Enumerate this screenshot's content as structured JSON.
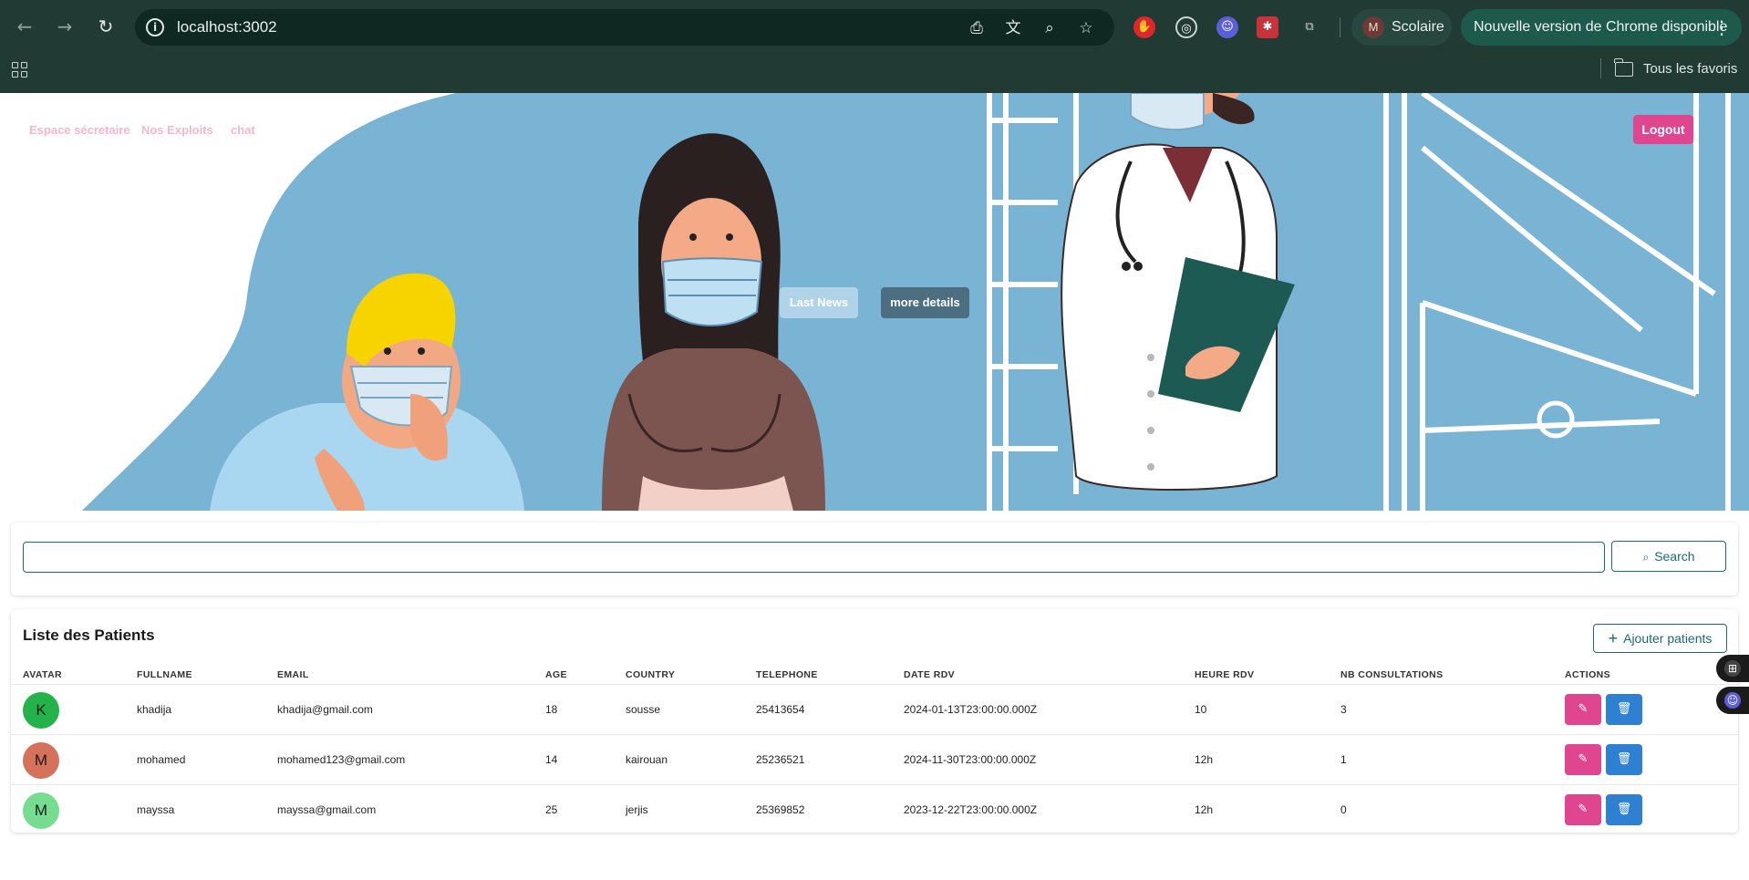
{
  "browser": {
    "url": "localhost:3002",
    "profile_name": "Scolaire",
    "profile_initial": "M",
    "update_text": "Nouvelle version de Chrome disponible",
    "bookmarks_label": "Tous les favoris"
  },
  "header": {
    "nav": [
      "Espace sécretaire",
      "Nos Exploits",
      "chat"
    ],
    "logout_label": "Logout",
    "hero_button_1": "Last News",
    "hero_button_2": "more details"
  },
  "search": {
    "value": "",
    "button_label": "Search"
  },
  "patients": {
    "title": "Liste des Patients",
    "add_label": "Ajouter patients",
    "columns": [
      "AVATAR",
      "FULLNAME",
      "EMAIL",
      "AGE",
      "COUNTRY",
      "TELEPHONE",
      "DATE RDV",
      "HEURE RDV",
      "NB CONSULTATIONS",
      "ACTIONS"
    ],
    "rows": [
      {
        "initial": "K",
        "avatar_color": "#24b34a",
        "fullname": "khadija",
        "email": "khadija@gmail.com",
        "age": "18",
        "country": "sousse",
        "telephone": "25413654",
        "date_rdv": "2024-01-13T23:00:00.000Z",
        "heure_rdv": "10",
        "nb_consultations": "3"
      },
      {
        "initial": "M",
        "avatar_color": "#d4735a",
        "fullname": "mohamed",
        "email": "mohamed123@gmail.com",
        "age": "14",
        "country": "kairouan",
        "telephone": "25236521",
        "date_rdv": "2024-11-30T23:00:00.000Z",
        "heure_rdv": "12h",
        "nb_consultations": "1"
      },
      {
        "initial": "M",
        "avatar_color": "#76dd90",
        "fullname": "mayssa",
        "email": "mayssa@gmail.com",
        "age": "25",
        "country": "jerjis",
        "telephone": "25369852",
        "date_rdv": "2023-12-22T23:00:00.000Z",
        "heure_rdv": "12h",
        "nb_consultations": "0"
      }
    ]
  },
  "colors": {
    "accent": "#1b6a73",
    "logout": "#e04690",
    "edit": "#e04690",
    "delete": "#2d80d2",
    "hero_blue": "#7ab4d4"
  }
}
